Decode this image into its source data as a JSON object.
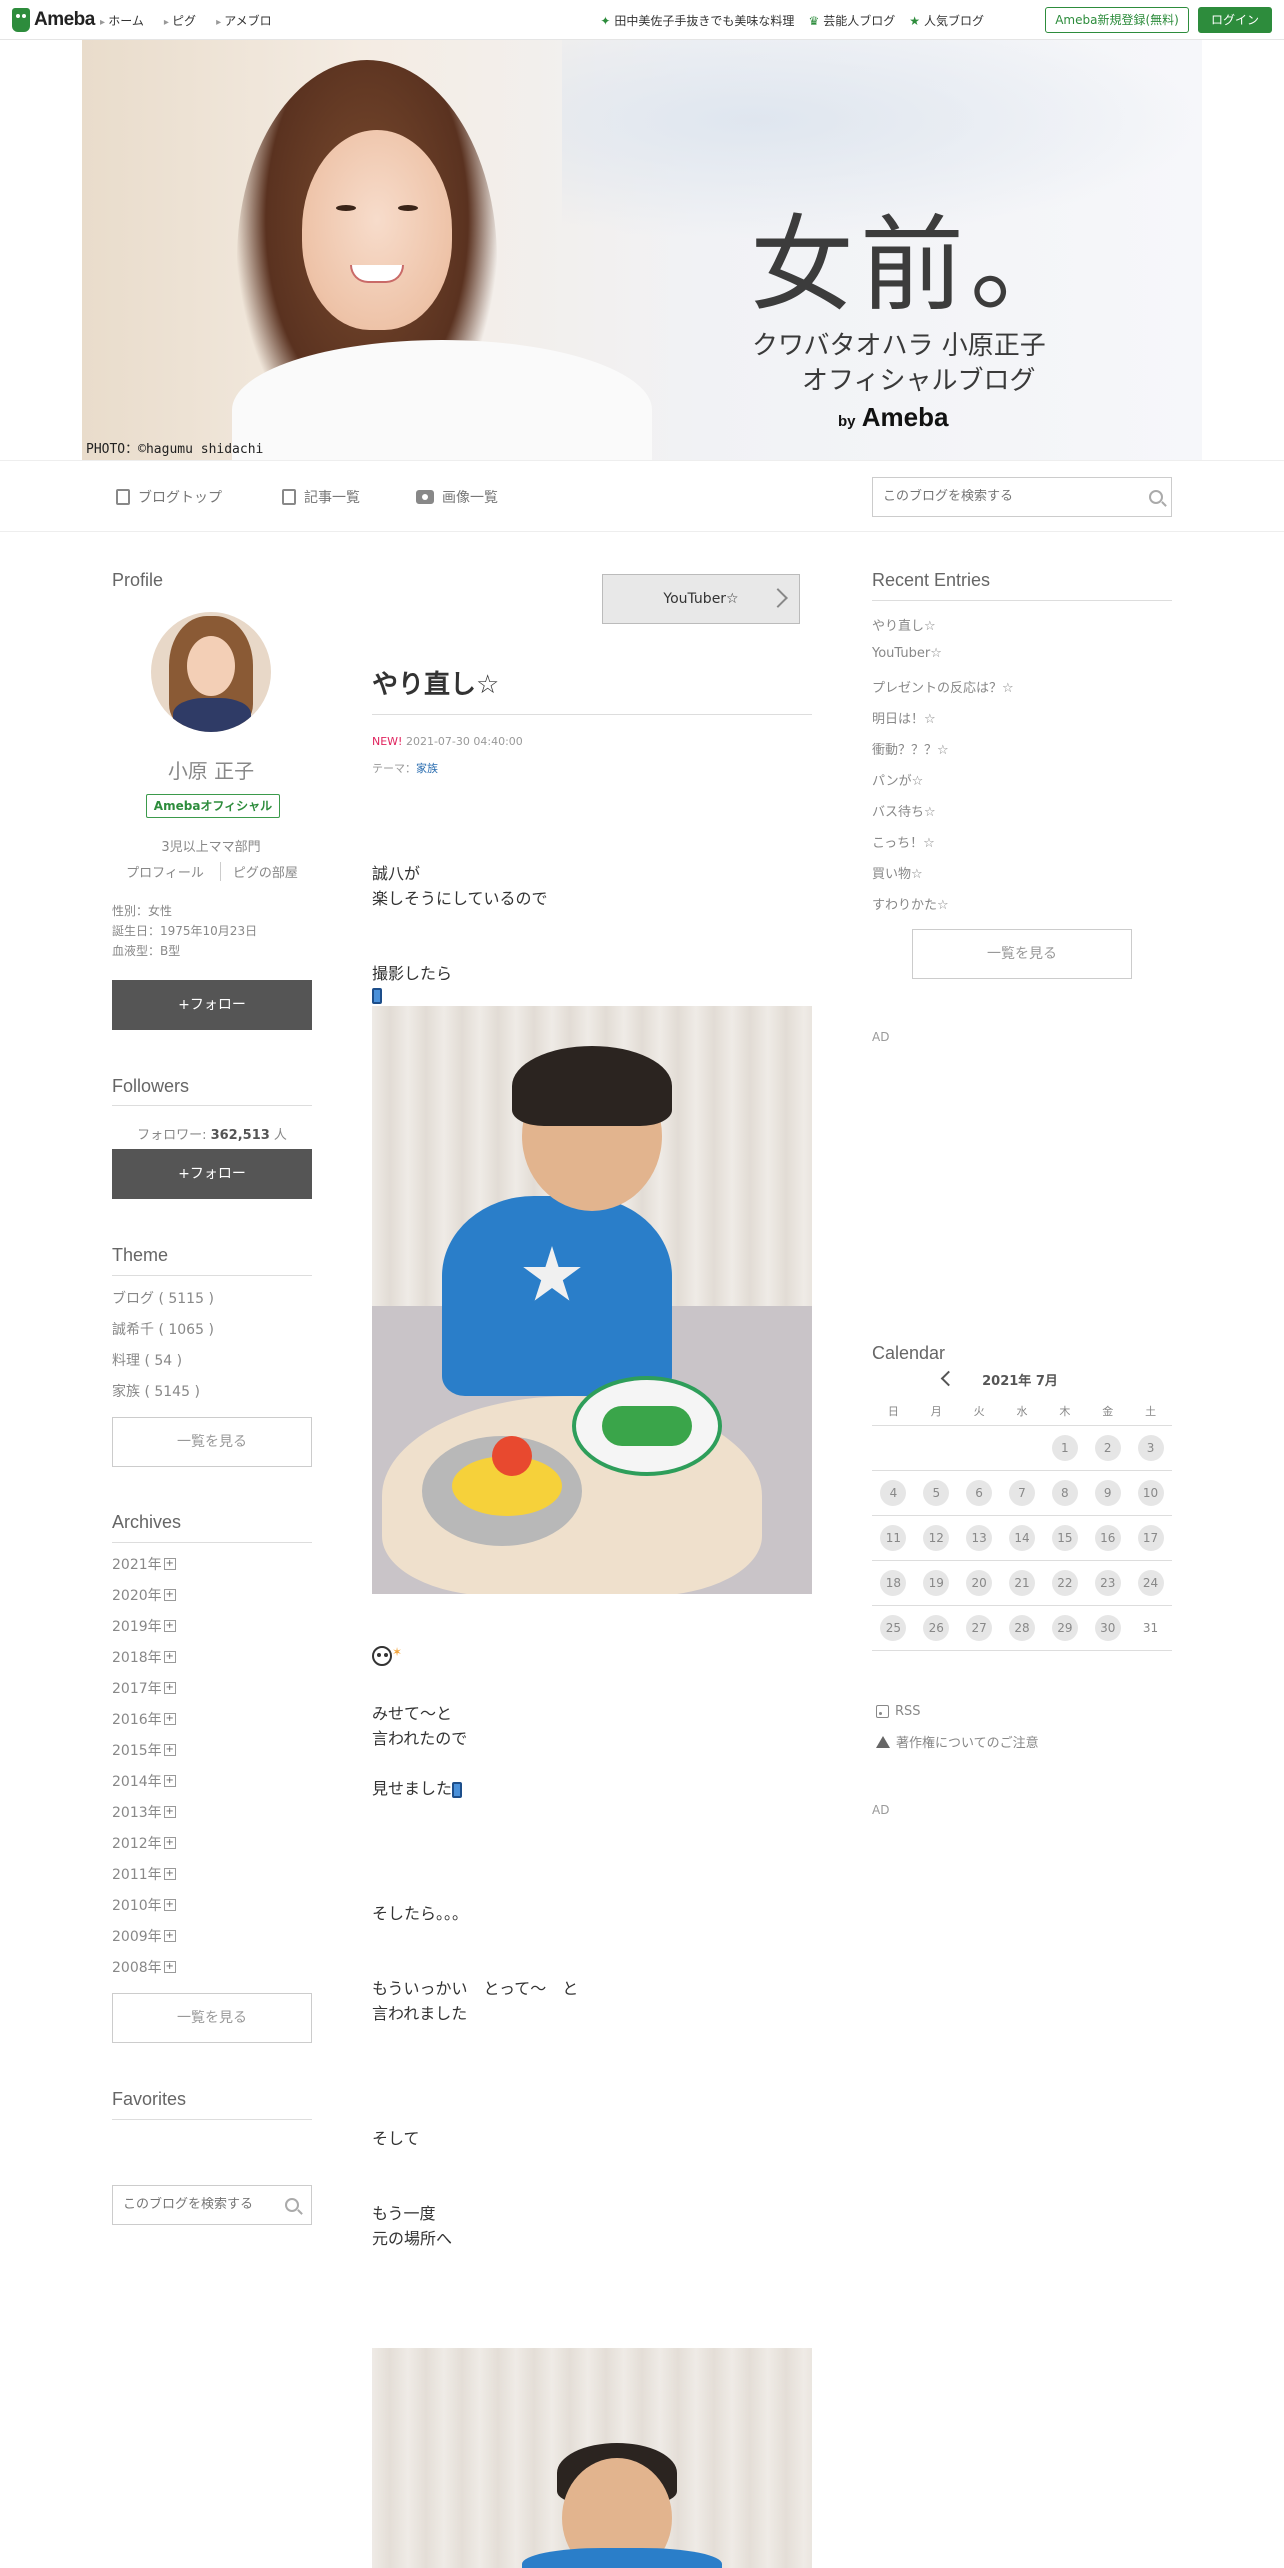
{
  "topbar": {
    "logo": "Ameba",
    "nav": [
      "ホーム",
      "ピグ",
      "アメブロ"
    ],
    "links": [
      "田中美佐子手抜きでも美味な料理",
      "芸能人ブログ",
      "人気ブログ"
    ],
    "register": "Ameba新規登録(無料)",
    "login": "ログイン"
  },
  "banner": {
    "title": "女前。",
    "subtitle1": "クワバタオハラ 小原正子",
    "subtitle2": "オフィシャルブログ",
    "by": "by",
    "brand": "Ameba",
    "credit": "PHOTO：©hagumu shidachi"
  },
  "subnav": {
    "blog_top": "ブログトップ",
    "entries": "記事一覧",
    "images": "画像一覧",
    "search_placeholder": "このブログを検索する"
  },
  "profile": {
    "heading": "Profile",
    "name": "小原 正子",
    "badge": "Amebaオフィシャル",
    "desc": "3児以上ママ部門",
    "link_profile": "プロフィール",
    "link_room": "ピグの部屋",
    "gender": "性別：女性",
    "birthday": "誕生日：1975年10月23日",
    "blood": "血液型：B型",
    "follow": "+フォロー"
  },
  "followers": {
    "heading": "Followers",
    "label": "フォロワー: ",
    "count": "362,513",
    "unit": " 人",
    "follow": "+フォロー"
  },
  "theme": {
    "heading": "Theme",
    "items": [
      "ブログ ( 5115 )",
      "誠希千 ( 1065 )",
      "料理 ( 54 )",
      "家族 ( 5145 )"
    ],
    "more": "一覧を見る"
  },
  "archives": {
    "heading": "Archives",
    "items": [
      "2021年",
      "2020年",
      "2019年",
      "2018年",
      "2017年",
      "2016年",
      "2015年",
      "2014年",
      "2013年",
      "2012年",
      "2011年",
      "2010年",
      "2009年",
      "2008年"
    ],
    "more": "一覧を見る"
  },
  "favorites": {
    "heading": "Favorites",
    "search_placeholder": "このブログを検索する"
  },
  "article": {
    "prev": "YouTuber☆",
    "title": "やり直し☆",
    "new": "NEW!",
    "date": " 2021-07-30 04:40:00",
    "theme_label": "テーマ：",
    "theme": "家族",
    "lines": {
      "l1": "誠八が",
      "l2": "楽しそうにしているので",
      "l3": "撮影したら",
      "l4": "みせて～と",
      "l5": "言われたので",
      "l6": "見せました",
      "l7": "そしたら。。。",
      "l8": "もういっかい　とって～　と",
      "l9": "言われました",
      "l10": "そして",
      "l11": "もう一度",
      "l12": "元の場所へ"
    }
  },
  "recent": {
    "heading": "Recent Entries",
    "items": [
      "やり直し☆",
      "YouTuber☆",
      "プレゼントの反応は？☆",
      "明日は！☆",
      "衝動？？？☆",
      "パンが☆",
      "バス待ち☆",
      "こっち！☆",
      "買い物☆",
      "すわりかた☆"
    ],
    "more": "一覧を見る"
  },
  "ad": "AD",
  "calendar": {
    "heading": "Calendar",
    "month": "2021年 7月",
    "dow": [
      "日",
      "月",
      "火",
      "水",
      "木",
      "金",
      "土"
    ],
    "weeks": [
      [
        "",
        "",
        "",
        "",
        "1",
        "2",
        "3"
      ],
      [
        "4",
        "5",
        "6",
        "7",
        "8",
        "9",
        "10"
      ],
      [
        "11",
        "12",
        "13",
        "14",
        "15",
        "16",
        "17"
      ],
      [
        "18",
        "19",
        "20",
        "21",
        "22",
        "23",
        "24"
      ],
      [
        "25",
        "26",
        "27",
        "28",
        "29",
        "30",
        "31"
      ]
    ]
  },
  "sidelinks": {
    "rss": "RSS",
    "copyright": "著作権についてのご注意"
  }
}
